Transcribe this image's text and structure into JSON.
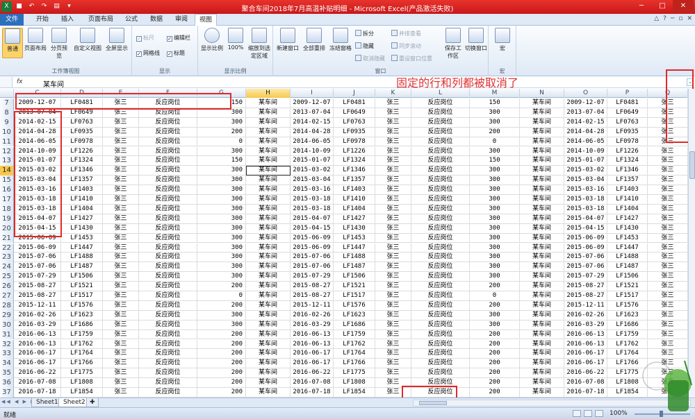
{
  "window": {
    "title": "聚合车间2018年7月高温补贴明细 - Microsoft Excel(产品激活失败)"
  },
  "tabs": [
    "文件",
    "开始",
    "插入",
    "页面布局",
    "公式",
    "数据",
    "审阅",
    "视图"
  ],
  "ribbon": {
    "workbook_views": {
      "label": "工作簿视图",
      "buttons": [
        "普通",
        "页面布局",
        "分页预览",
        "自定义视图",
        "全屏显示"
      ]
    },
    "show": {
      "label": "显示",
      "items": [
        {
          "text": "标尺",
          "checked": true,
          "dim": true
        },
        {
          "text": "编辑栏",
          "checked": true
        },
        {
          "text": "网格线",
          "checked": true
        },
        {
          "text": "标题",
          "checked": true
        }
      ]
    },
    "zoom": {
      "label": "显示比例",
      "buttons": [
        "显示比例",
        "100%",
        "缩放到选定区域"
      ]
    },
    "window": {
      "label": "窗口",
      "buttons": [
        "新建窗口",
        "全部重排",
        "冻结窗格"
      ],
      "small": [
        "拆分",
        "隐藏",
        "取消隐藏",
        "并排查看",
        "同步滚动",
        "重设窗口位置"
      ],
      "save": "保存工作区",
      "switch": "切换窗口"
    },
    "macro": {
      "label": "宏",
      "button": "宏"
    }
  },
  "formula_bar": {
    "fx": "fx",
    "value": "某车间",
    "annotation": "固定的行和列都被取消了"
  },
  "columns": [
    "C",
    "D",
    "E",
    "F",
    "G",
    "H",
    "I",
    "J",
    "K",
    "L",
    "M",
    "N",
    "O",
    "P",
    "Q"
  ],
  "selected_column": "H",
  "selected_row": "14",
  "rows": [
    {
      "n": "7",
      "d": "2009-12-07",
      "id": "LF0481",
      "amt": "150"
    },
    {
      "n": "8",
      "d": "2013-07-04",
      "id": "LF0649",
      "amt": "300"
    },
    {
      "n": "9",
      "d": "2014-02-15",
      "id": "LF0763",
      "amt": "300"
    },
    {
      "n": "10",
      "d": "2014-04-28",
      "id": "LF0935",
      "amt": "200"
    },
    {
      "n": "11",
      "d": "2014-06-05",
      "id": "LF0978",
      "amt": "0"
    },
    {
      "n": "12",
      "d": "2014-10-09",
      "id": "LF1226",
      "amt": "300"
    },
    {
      "n": "13",
      "d": "2015-01-07",
      "id": "LF1324",
      "amt": "150"
    },
    {
      "n": "14",
      "d": "2015-03-02",
      "id": "LF1346",
      "amt": "300"
    },
    {
      "n": "15",
      "d": "2015-03-04",
      "id": "LF1357",
      "amt": "300"
    },
    {
      "n": "16",
      "d": "2015-03-16",
      "id": "LF1403",
      "amt": "300"
    },
    {
      "n": "17",
      "d": "2015-03-18",
      "id": "LF1410",
      "amt": "300"
    },
    {
      "n": "18",
      "d": "2015-03-18",
      "id": "LF1404",
      "amt": "300"
    },
    {
      "n": "19",
      "d": "2015-04-07",
      "id": "LF1427",
      "amt": "300"
    },
    {
      "n": "20",
      "d": "2015-04-15",
      "id": "LF1430",
      "amt": "300"
    },
    {
      "n": "21",
      "d": "2015-06-09",
      "id": "LF1453",
      "amt": "300"
    },
    {
      "n": "22",
      "d": "2015-06-09",
      "id": "LF1447",
      "amt": "300"
    },
    {
      "n": "23",
      "d": "2015-07-06",
      "id": "LF1488",
      "amt": "300"
    },
    {
      "n": "24",
      "d": "2015-07-06",
      "id": "LF1487",
      "amt": "300"
    },
    {
      "n": "25",
      "d": "2015-07-29",
      "id": "LF1506",
      "amt": "300"
    },
    {
      "n": "26",
      "d": "2015-08-27",
      "id": "LF1521",
      "amt": "200"
    },
    {
      "n": "27",
      "d": "2015-08-27",
      "id": "LF1517",
      "amt": "0"
    },
    {
      "n": "28",
      "d": "2015-12-11",
      "id": "LF1576",
      "amt": "200"
    },
    {
      "n": "29",
      "d": "2016-02-26",
      "id": "LF1623",
      "amt": "300"
    },
    {
      "n": "30",
      "d": "2016-03-29",
      "id": "LF1686",
      "amt": "300"
    },
    {
      "n": "31",
      "d": "2016-06-13",
      "id": "LF1759",
      "amt": "200"
    },
    {
      "n": "32",
      "d": "2016-06-13",
      "id": "LF1762",
      "amt": "200"
    },
    {
      "n": "33",
      "d": "2016-06-17",
      "id": "LF1764",
      "amt": "200"
    },
    {
      "n": "34",
      "d": "2016-06-17",
      "id": "LF1766",
      "amt": "200"
    },
    {
      "n": "35",
      "d": "2016-06-22",
      "id": "LF1775",
      "amt": "200"
    },
    {
      "n": "36",
      "d": "2016-07-08",
      "id": "LF1808",
      "amt": "200"
    },
    {
      "n": "37",
      "d": "2016-07-18",
      "id": "LF1854",
      "amt": "200"
    }
  ],
  "constants": {
    "name": "张三",
    "position": "反应岗位",
    "workshop": "某车间"
  },
  "sheets": [
    "Sheet1",
    "Sheet2"
  ],
  "active_sheet": "Sheet2",
  "status": {
    "ready": "就绪",
    "zoom": "100%"
  },
  "colors": {
    "title_bar": "#d42523",
    "annotation": "#e03030",
    "file_tab": "#2e6fbd"
  }
}
